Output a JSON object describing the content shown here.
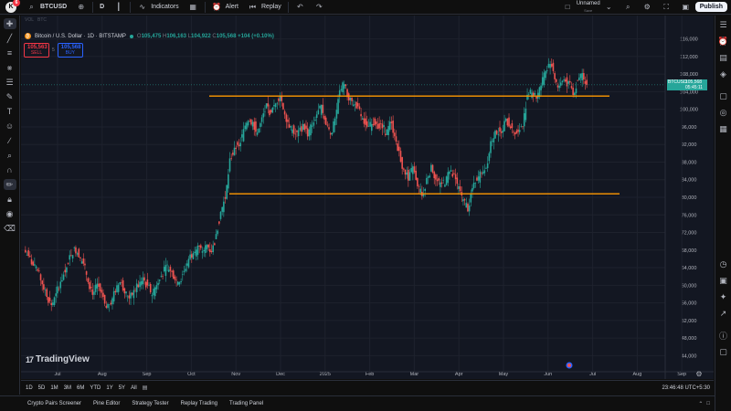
{
  "topbar": {
    "symbol": "BTCUSD",
    "interval": "D",
    "indicators_label": "Indicators",
    "alert_label": "Alert",
    "replay_label": "Replay",
    "layout_name": "Unnamed",
    "layout_sub": "Save",
    "publish_label": "Publish",
    "notif_count": "6"
  },
  "chart": {
    "tiny_labels": [
      "VOL",
      "BTC"
    ],
    "legend": {
      "title": "Bitcoin / U.S. Dollar · 1D · BITSTAMP",
      "o": "105,475",
      "h": "106,163",
      "l": "104,922",
      "c": "105,568",
      "change": "+104 (+0.10%)"
    },
    "sell": {
      "price": "105,563",
      "label": "SELL"
    },
    "buy": {
      "price": "105,568",
      "label": "BUY"
    },
    "spread": "5",
    "watermark": "TradingView",
    "price_label": {
      "symbol": "BTCUSD",
      "price": "105,568",
      "countdown": "05:45:11"
    }
  },
  "chart_data": {
    "type": "candlestick",
    "x_tick_labels": [
      "Jul",
      "Aug",
      "Sep",
      "Oct",
      "Nov",
      "Dec",
      "2025",
      "Feb",
      "Mar",
      "Apr",
      "May",
      "Jun",
      "Jul",
      "Aug",
      "Sep"
    ],
    "y_tick_labels": [
      "116,000",
      "112,000",
      "108,000",
      "104,000",
      "100,000",
      "96,000",
      "92,000",
      "88,000",
      "84,000",
      "80,000",
      "76,000",
      "72,000",
      "68,000",
      "64,000",
      "60,000",
      "56,000",
      "52,000",
      "48,000",
      "44,000"
    ],
    "ylim": [
      42000,
      118000
    ],
    "horizontal_lines": [
      103000,
      80800
    ],
    "last_price": 105568,
    "closes": [
      66500,
      64500,
      63000,
      60500,
      58000,
      55500,
      57500,
      61000,
      63000,
      66500,
      68000,
      67000,
      65000,
      61500,
      58500,
      60000,
      58000,
      54000,
      56500,
      59000,
      61000,
      59000,
      57500,
      58500,
      60000,
      62000,
      59500,
      58000,
      60500,
      63000,
      64000,
      63500,
      62000,
      61000,
      63500,
      66000,
      67500,
      68500,
      67000,
      69000,
      68000,
      71000,
      76500,
      80000,
      88000,
      90500,
      91500,
      95000,
      98000,
      97000,
      94000,
      97500,
      100500,
      98500,
      101000,
      103500,
      99000,
      96500,
      95000,
      94500,
      96000,
      94500,
      97000,
      99000,
      100500,
      96500,
      94500,
      97500,
      104000,
      106000,
      102000,
      101500,
      100000,
      97500,
      95500,
      96500,
      97500,
      96000,
      95000,
      96500,
      94500,
      90000,
      85500,
      84500,
      87000,
      82000,
      80500,
      84000,
      86500,
      84000,
      82500,
      83500,
      86500,
      84500,
      82000,
      79000,
      77500,
      82000,
      84500,
      86000,
      87500,
      92500,
      95000,
      94500,
      96500,
      97000,
      95000,
      94500,
      97000,
      103500,
      104000,
      103000,
      105500,
      108500,
      111000,
      107500,
      104500,
      107000,
      105500,
      104000,
      106500,
      108000,
      105568
    ]
  },
  "ranges": [
    "1D",
    "5D",
    "1M",
    "3M",
    "6M",
    "YTD",
    "1Y",
    "5Y",
    "All"
  ],
  "clock": "23:46:48 UTC+5:30",
  "panels": [
    "Crypto Pairs Screener",
    "Pine Editor",
    "Strategy Tester",
    "Replay Trading",
    "Trading Panel"
  ]
}
